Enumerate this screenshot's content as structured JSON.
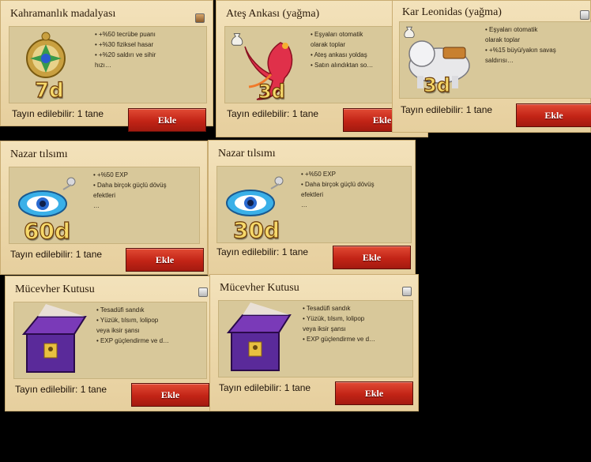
{
  "available_prefix": "Tayın edilebilir:",
  "button_label": "Ekle",
  "cards": {
    "c1": {
      "title": "Kahramanlık madalyası",
      "days": "7d",
      "features": [
        "• +%50 tecrübe puanı",
        "• +%30 fiziksel hasar",
        "• +%20 saldırı ve sihir",
        "hızı…"
      ],
      "available": "1 tane",
      "corner_icon": "item-icon"
    },
    "c2": {
      "title": "Ateş Ankası (yağma)",
      "days": "3d",
      "features": [
        "• Eşyaları otomatik",
        "olarak toplar",
        "• Ateş ankası yoldaş",
        "• Satın alındıktan so…"
      ],
      "available": "1 tane",
      "corner_icon": "loot-bag-icon"
    },
    "c3": {
      "title": "Kar Leonidas (yağma)",
      "days": "3d",
      "features": [
        "• Eşyaları otomatik",
        "olarak toplar",
        "• +%15 büyü/yakın savaş",
        "saldırısı…"
      ],
      "available": "1 tane",
      "corner_icon": "loot-bag-icon"
    },
    "c4": {
      "title": "Nazar tılsımı",
      "days": "60d",
      "features": [
        "• +%50 EXP",
        "• Daha birçok güçlü dövüş",
        "efektleri",
        "…"
      ],
      "available": "1 tane"
    },
    "c5": {
      "title": "Nazar tılsımı",
      "days": "30d",
      "features": [
        "• +%50 EXP",
        "• Daha birçok güçlü dövüş",
        "efektleri",
        "…"
      ],
      "available": "1 tane"
    },
    "c6": {
      "title": "Mücevher Kutusu",
      "features": [
        "• Tesadüfi sandık",
        "• Yüzük, tılsım, lolipop",
        "veya iksir şansı",
        "• EXP güçlendirme ve d…"
      ],
      "available": "1 tane",
      "corner_icon": "moon-icon"
    },
    "c7": {
      "title": "Mücevher Kutusu",
      "features": [
        "• Tesadüfi sandık",
        "• Yüzük, tılsım, lolipop",
        "veya iksir şansı",
        "• EXP güçlendirme ve d…"
      ],
      "available": "1 tane",
      "corner_icon": "moon-icon"
    }
  },
  "colors": {
    "button_red": "#c22416",
    "days_gold": "#f5d86a",
    "panel_parchment": "#ecd7a9"
  }
}
